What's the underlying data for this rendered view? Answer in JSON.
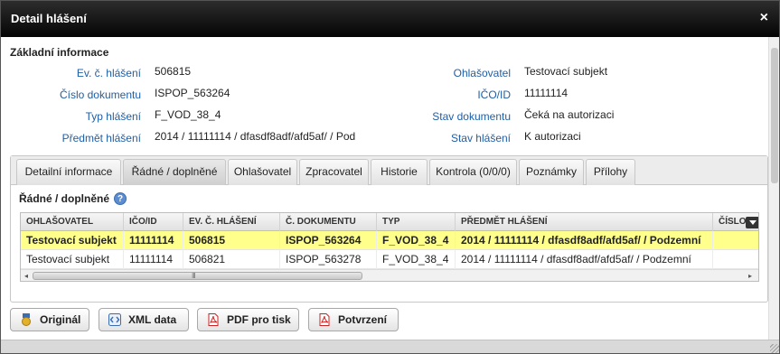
{
  "dialog": {
    "title": "Detail hlášení",
    "close_symbol": "×"
  },
  "basic_info": {
    "heading": "Základní informace",
    "left": [
      {
        "label": "Ev. č. hlášení",
        "value": "506815"
      },
      {
        "label": "Číslo dokumentu",
        "value": "ISPOP_563264"
      },
      {
        "label": "Typ hlášení",
        "value": "F_VOD_38_4"
      },
      {
        "label": "Předmět hlášení",
        "value": "2014 / 11111114 / dfasdf8adf/afd5af/ / Pod"
      }
    ],
    "right": [
      {
        "label": "Ohlašovatel",
        "value": "Testovací subjekt"
      },
      {
        "label": "IČO/ID",
        "value": "11111114"
      },
      {
        "label": "Stav dokumentu",
        "value": "Čeká na autorizaci"
      },
      {
        "label": "Stav hlášení",
        "value": "K autorizaci"
      }
    ]
  },
  "tabs": [
    {
      "label": "Detailní informace",
      "active": false
    },
    {
      "label": "Řádné / doplněné",
      "active": true
    },
    {
      "label": "Ohlašovatel",
      "active": false
    },
    {
      "label": "Zpracovatel",
      "active": false
    },
    {
      "label": "Historie",
      "active": false
    },
    {
      "label": "Kontrola (0/0/0)",
      "active": false
    },
    {
      "label": "Poznámky",
      "active": false
    },
    {
      "label": "Přílohy",
      "active": false
    }
  ],
  "panel": {
    "heading": "Řádné / doplněné",
    "help_symbol": "?"
  },
  "grid": {
    "columns": [
      "OHLAŠOVATEL",
      "IČO/ID",
      "EV. Č. HLÁŠENÍ",
      "Č. DOKUMENTU",
      "TYP",
      "PŘEDMĚT HLÁŠENÍ",
      "ČÍSLO"
    ],
    "rows": [
      {
        "selected": true,
        "cells": [
          "Testovací subjekt",
          "11111114",
          "506815",
          "ISPOP_563264",
          "F_VOD_38_4",
          "2014 / 11111114 / dfasdf8adf/afd5af/ / Podzemní",
          ""
        ]
      },
      {
        "selected": false,
        "cells": [
          "Testovací subjekt",
          "11111114",
          "506821",
          "ISPOP_563278",
          "F_VOD_38_4",
          "2014 / 11111114 / dfasdf8adf/afd5af/ / Podzemní",
          ""
        ]
      }
    ],
    "scroll_left": "◂",
    "scroll_right": "▸",
    "scroll_grip": "III"
  },
  "buttons": [
    {
      "label": "Originál",
      "icon": "medal-icon"
    },
    {
      "label": "XML data",
      "icon": "xml-icon"
    },
    {
      "label": "PDF pro tisk",
      "icon": "pdf-icon"
    },
    {
      "label": "Potvrzení",
      "icon": "pdf-icon"
    }
  ],
  "colors": {
    "label_blue": "#1f5fa6",
    "selected_row": "#ffff8c",
    "titlebar": "#111111"
  }
}
